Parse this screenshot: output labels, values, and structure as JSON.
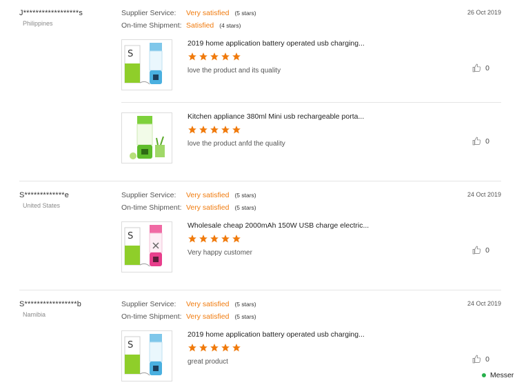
{
  "reviews": [
    {
      "buyer": "J******************s",
      "country": "Philippines",
      "date": "26 Oct 2019",
      "supplier_label": "Supplier Service:",
      "supplier_value": "Very satisfied",
      "supplier_stars": "(5 stars)",
      "shipment_label": "On-time Shipment:",
      "shipment_value": "Satisfied",
      "shipment_stars": "(4 stars)",
      "products": [
        {
          "title": "2019 home application battery operated usb charging...",
          "rating": 5,
          "comment": "love the product and its quality",
          "likes": "0",
          "image": "blender-blue-box"
        },
        {
          "title": "Kitchen appliance 380ml Mini usb rechargeable porta...",
          "rating": 5,
          "comment": "love the product anfd the quality",
          "likes": "0",
          "image": "blender-green-juice"
        }
      ]
    },
    {
      "buyer": "S*************e",
      "country": "United States",
      "date": "24 Oct 2019",
      "supplier_label": "Supplier Service:",
      "supplier_value": "Very satisfied",
      "supplier_stars": "(5 stars)",
      "shipment_label": "On-time Shipment:",
      "shipment_value": "Very satisfied",
      "shipment_stars": "(5 stars)",
      "products": [
        {
          "title": "Wholesale cheap 2000mAh 150W USB charge electric...",
          "rating": 5,
          "comment": "Very happy customer",
          "likes": "0",
          "image": "blender-pink-box"
        }
      ]
    },
    {
      "buyer": "S*****************b",
      "country": "Namibia",
      "date": "24 Oct 2019",
      "supplier_label": "Supplier Service:",
      "supplier_value": "Very satisfied",
      "supplier_stars": "(5 stars)",
      "shipment_label": "On-time Shipment:",
      "shipment_value": "Very satisfied",
      "shipment_stars": "(5 stars)",
      "products": [
        {
          "title": "2019 home application battery operated usb charging...",
          "rating": 5,
          "comment": "great product",
          "likes": "0",
          "image": "blender-blue-box"
        }
      ]
    }
  ],
  "messenger": {
    "label": "Messer",
    "status_color": "#27b04b"
  },
  "colors": {
    "accent": "#f07a0c",
    "star": "#f07a0c"
  }
}
